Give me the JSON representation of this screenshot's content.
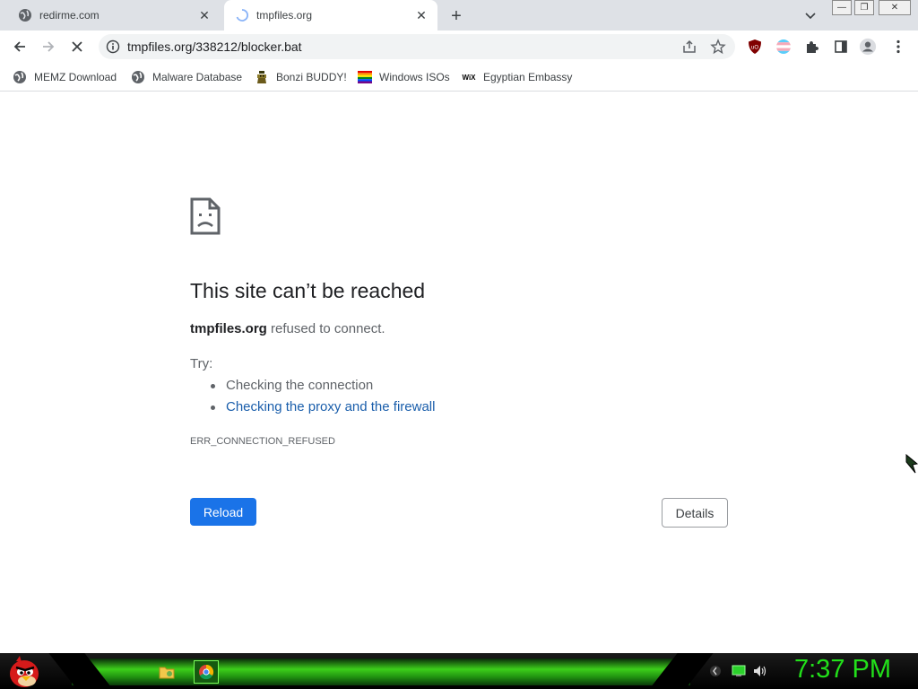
{
  "browser": {
    "tabs": [
      {
        "title": "redirme.com",
        "active": false,
        "favicon": "globe-icon"
      },
      {
        "title": "tmpfiles.org",
        "active": true,
        "favicon": "loading-spinner-icon"
      }
    ],
    "address_bar": {
      "url": "tmpfiles.org/338212/blocker.bat"
    },
    "bookmarks": [
      {
        "label": "MEMZ Download",
        "icon": "globe-icon"
      },
      {
        "label": "Malware Database",
        "icon": "globe-icon"
      },
      {
        "label": "Bonzi BUDDY!",
        "icon": "bonzi-icon"
      },
      {
        "label": "Windows ISOs",
        "icon": "rainbow-flag-icon"
      },
      {
        "label": "Egyptian Embassy",
        "icon": "wix-icon"
      }
    ],
    "bookmark_wix_text": "WiX"
  },
  "error_page": {
    "title": "This site can’t be reached",
    "host": "tmpfiles.org",
    "description_suffix": " refused to connect.",
    "try_label": "Try:",
    "suggestions": [
      {
        "text": "Checking the connection",
        "link": false
      },
      {
        "text": "Checking the proxy and the firewall",
        "link": true
      }
    ],
    "error_code": "ERR_CONNECTION_REFUSED",
    "reload_label": "Reload",
    "details_label": "Details"
  },
  "taskbar": {
    "clock": "7:37 PM",
    "items": [
      "folder-icon",
      "chrome-icon"
    ]
  },
  "colors": {
    "accent": "#1a73e8",
    "link": "#1a5eab",
    "clock": "#22e01a"
  }
}
